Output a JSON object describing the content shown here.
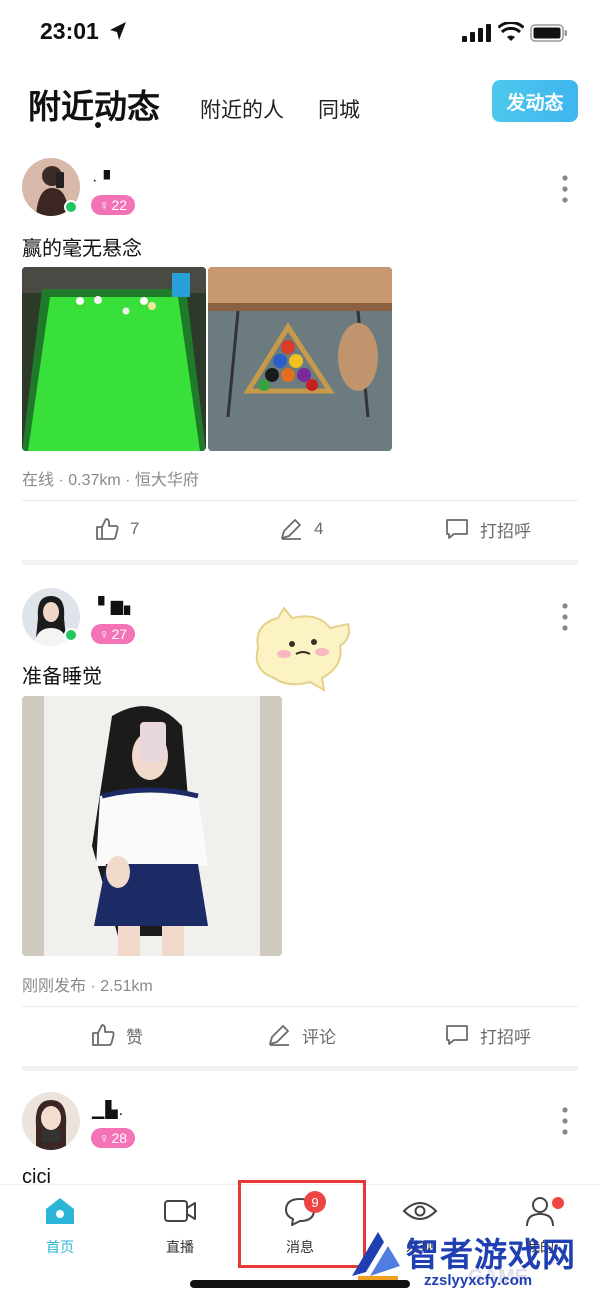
{
  "status_bar": {
    "time": "23:01"
  },
  "header": {
    "tabs": [
      {
        "label": "附近动态",
        "active": true
      },
      {
        "label": "附近的人",
        "active": false
      },
      {
        "label": "同城",
        "active": false
      }
    ],
    "post_button": "发动态"
  },
  "posts": [
    {
      "username": "·  ▘",
      "age": "22",
      "online": true,
      "text": "赢的毫无悬念",
      "photos": [
        "pool-table-photo",
        "billiard-balls-rack-photo"
      ],
      "meta": "在线 · 0.37km · 恒大华府",
      "actions": {
        "like": "7",
        "comment": "4",
        "greet": "打招呼"
      }
    },
    {
      "username": "▝ ▆▖",
      "age": "27",
      "online": true,
      "text": "准备睡觉",
      "photos": [
        "mirror-selfie-photo"
      ],
      "meta": "刚刚发布 · 2.51km",
      "actions": {
        "like": "赞",
        "comment": "评论",
        "greet": "打招呼"
      }
    },
    {
      "username": "▁▙.",
      "age": "28",
      "online": false,
      "text": "cici"
    }
  ],
  "tabbar": {
    "items": [
      {
        "label": "首页",
        "icon": "home-icon",
        "active": true
      },
      {
        "label": "直播",
        "icon": "video-camera-icon",
        "active": false
      },
      {
        "label": "消息",
        "icon": "chat-bubble-icon",
        "active": false,
        "badge": "9"
      },
      {
        "label": "发现",
        "icon": "eye-icon",
        "active": false
      },
      {
        "label": "我的",
        "icon": "person-icon",
        "active": false,
        "dot": true
      }
    ]
  },
  "watermark": {
    "title": "智者游戏网",
    "url": "zzslyyxcfy.com",
    "overlay": "GAME"
  },
  "colors": {
    "accent": "#2bb6d8",
    "badge_pink": "#f472b6",
    "online_green": "#22c55e",
    "alert_red": "#ef4444"
  }
}
